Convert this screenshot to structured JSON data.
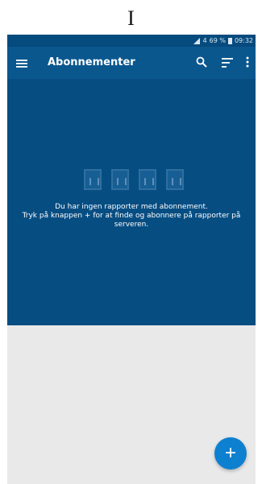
{
  "header": {
    "caption": "I"
  },
  "status_bar": {
    "signal_label": "4",
    "battery": "69 %",
    "time": "09:32"
  },
  "app_bar": {
    "title": "Abonnementer"
  },
  "empty_state": {
    "line1": "Du har ingen rapporter med abonnement.",
    "line2": "Tryk på knappen + for at finde og abonnere på rapporter på serveren."
  },
  "fab": {
    "label": "+"
  },
  "colors": {
    "status_bar": "#064b7e",
    "app_bar": "#0a578e",
    "content_background": "#064d82",
    "fab": "#0d80d0",
    "page_background": "#e9e9e9"
  }
}
